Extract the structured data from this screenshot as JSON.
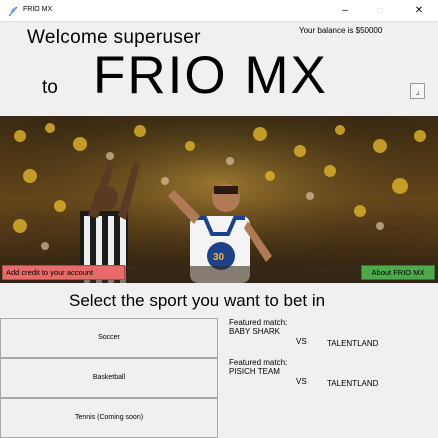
{
  "window": {
    "title": "FRIO MX",
    "minimize": "–",
    "maximize": "□",
    "close": "✕"
  },
  "header": {
    "welcome": "Welcome  superuser",
    "balance": "Your balance is $50000",
    "to": "to",
    "brand": "FRIO MX",
    "scroll_glyph": "⌟"
  },
  "hero": {
    "credit_button": "Add credit to your account",
    "about_button": "About FRIO MX",
    "jersey_number": "30"
  },
  "sports": {
    "title": "Select the sport you want to bet in",
    "buttons": [
      "Soccer",
      "Basketball",
      "Tennis (Coming soon)"
    ],
    "featured": [
      {
        "label": "Featured match:",
        "team1": "BABY SHARK",
        "vs": "VS",
        "team2": "TALENTLAND"
      },
      {
        "label": "Featured match:",
        "team1": "PISICH TEAM",
        "vs": "VS",
        "team2": "TALENTLAND"
      }
    ]
  },
  "colors": {
    "credit_button": "#e86b6b",
    "about_button": "#4caa4c",
    "background": "#f0f0f0"
  }
}
